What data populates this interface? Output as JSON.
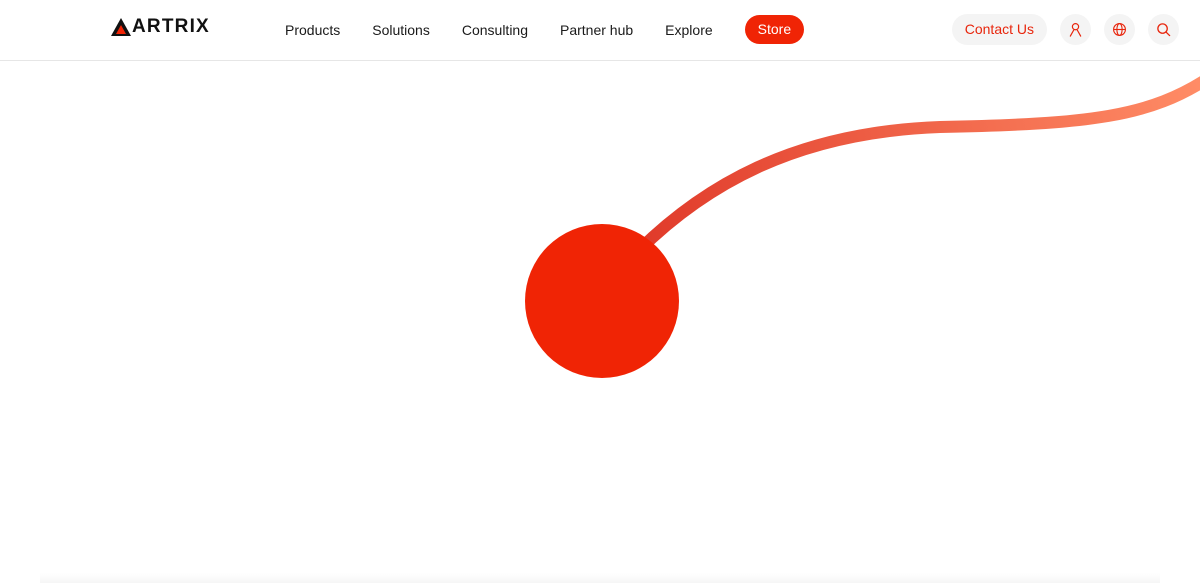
{
  "brand": {
    "name": "ARTRIX",
    "logo_icon": "triangle-logo-icon",
    "logo_color": "#f02405"
  },
  "nav": {
    "items": [
      {
        "label": "Products"
      },
      {
        "label": "Solutions"
      },
      {
        "label": "Consulting"
      },
      {
        "label": "Partner hub"
      },
      {
        "label": "Explore"
      }
    ],
    "store_label": "Store"
  },
  "actions": {
    "contact_label": "Contact Us",
    "icons": [
      "user-icon",
      "globe-icon",
      "search-icon"
    ]
  },
  "theme": {
    "accent": "#f02405",
    "accent_text": "#e8260d",
    "curve_start": "#e03a2a",
    "curve_end": "#ff8c66",
    "button_bg": "#f4f4f4"
  }
}
